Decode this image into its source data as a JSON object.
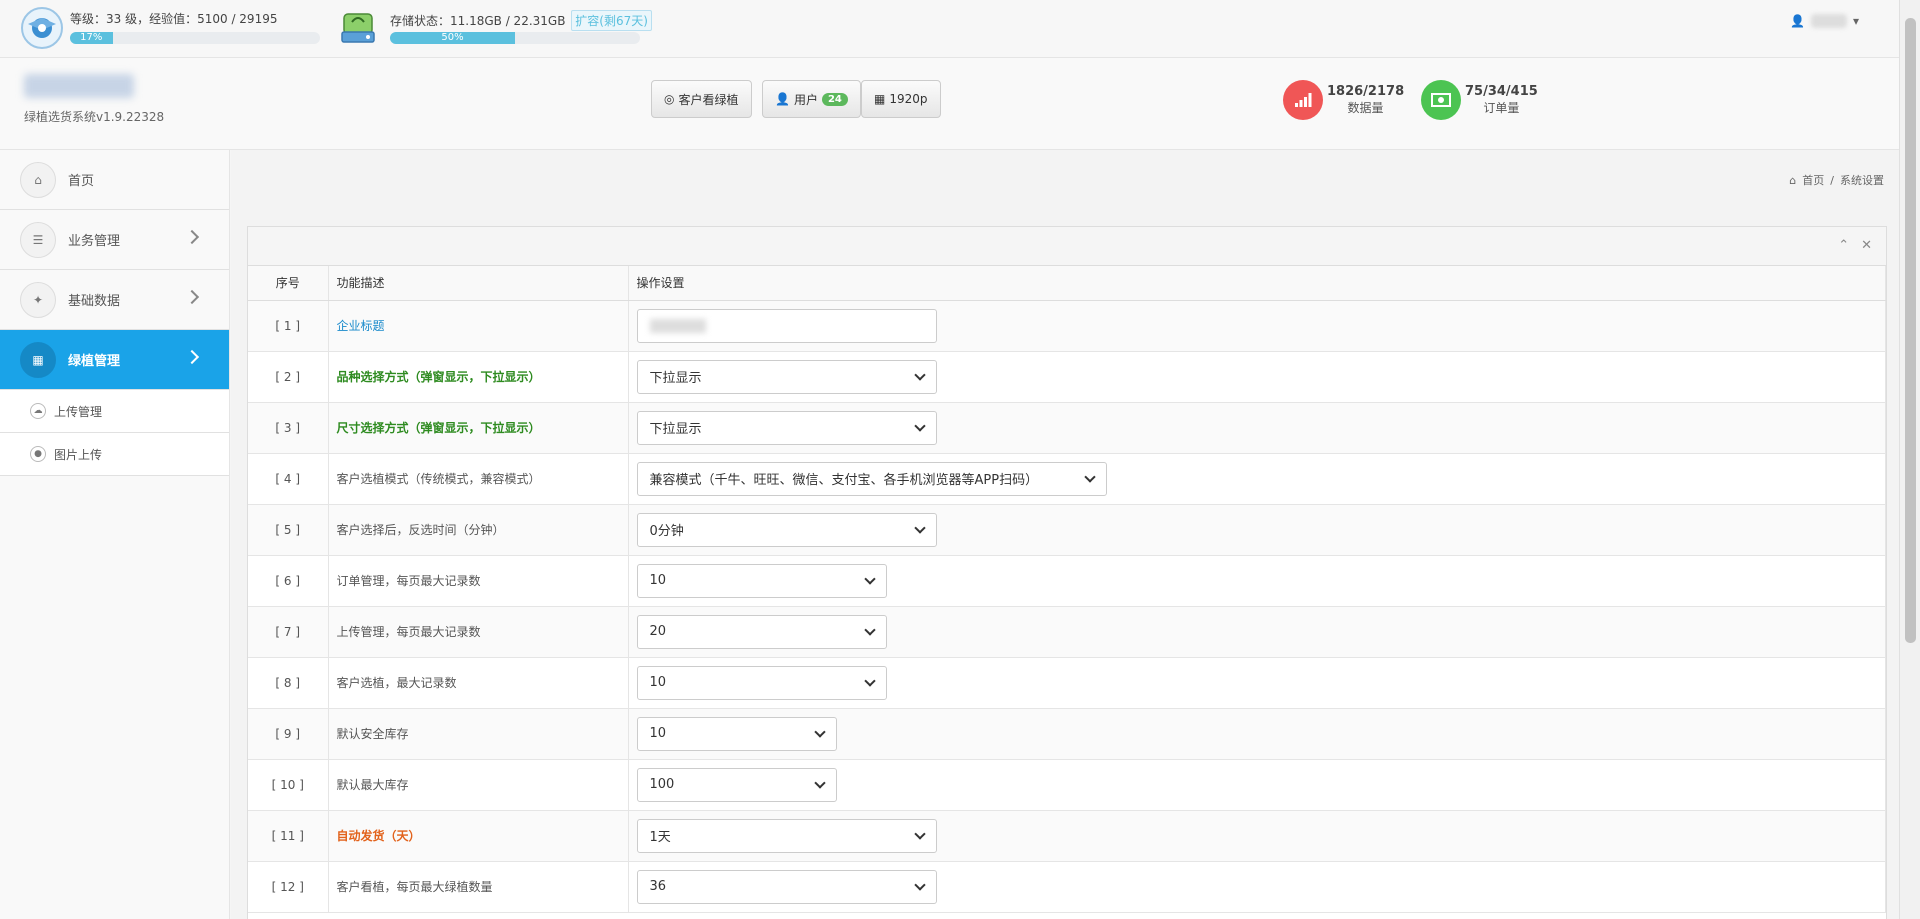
{
  "topbar": {
    "level_text": "等级：33 级，经验值：5100 / 29195",
    "level_progress_label": "17%",
    "level_progress": 17,
    "storage_text": "存储状态：11.18GB / 22.31GB",
    "expand_label": "扩容(剩67天)",
    "storage_progress_label": "50%",
    "storage_progress": 50
  },
  "header": {
    "version": "绿植选货系统v1.9.22328",
    "btn_customer_view": "客户看绿植",
    "btn_users": "用户",
    "users_count": "24",
    "btn_resolution": "1920p",
    "stat_data_value": "1826/2178",
    "stat_data_label": "数据量",
    "stat_order_value": "75/34/415",
    "stat_order_label": "订单量"
  },
  "sidebar": {
    "items": [
      {
        "label": "首页"
      },
      {
        "label": "业务管理"
      },
      {
        "label": "基础数据"
      },
      {
        "label": "绿植管理"
      }
    ],
    "subitems": [
      {
        "label": "上传管理"
      },
      {
        "label": "图片上传"
      }
    ]
  },
  "breadcrumb": {
    "home": "首页",
    "separator": "/",
    "current": "系统设置"
  },
  "table": {
    "headers": [
      "序号",
      "功能描述",
      "操作设置"
    ],
    "rows": [
      {
        "idx": "[ 1 ]",
        "desc": "企业标题",
        "value": ""
      },
      {
        "idx": "[ 2 ]",
        "desc": "品种选择方式（弹窗显示，下拉显示）",
        "value": "下拉显示"
      },
      {
        "idx": "[ 3 ]",
        "desc": "尺寸选择方式（弹窗显示，下拉显示）",
        "value": "下拉显示"
      },
      {
        "idx": "[ 4 ]",
        "desc": "客户选植模式（传统模式，兼容模式）",
        "value": "兼容模式（千牛、旺旺、微信、支付宝、各手机浏览器等APP扫码）"
      },
      {
        "idx": "[ 5 ]",
        "desc": "客户选择后，反选时间（分钟）",
        "value": "0分钟"
      },
      {
        "idx": "[ 6 ]",
        "desc": "订单管理，每页最大记录数",
        "value": "10"
      },
      {
        "idx": "[ 7 ]",
        "desc": "上传管理，每页最大记录数",
        "value": "20"
      },
      {
        "idx": "[ 8 ]",
        "desc": "客户选植，最大记录数",
        "value": "10"
      },
      {
        "idx": "[ 9 ]",
        "desc": "默认安全库存",
        "value": "10"
      },
      {
        "idx": "[ 10 ]",
        "desc": "默认最大库存",
        "value": "100"
      },
      {
        "idx": "[ 11 ]",
        "desc": "自动发货（天）",
        "value": "1天"
      },
      {
        "idx": "[ 12 ]",
        "desc": "客户看植，每页最大绿植数量",
        "value": "36"
      }
    ]
  },
  "colors": {
    "accent": "#1aa3e8",
    "stat_red": "#f05656",
    "stat_green": "#4cc452",
    "label_blue": "#1a8acb",
    "label_green": "#2e8b20",
    "label_orange": "#e2621b"
  }
}
